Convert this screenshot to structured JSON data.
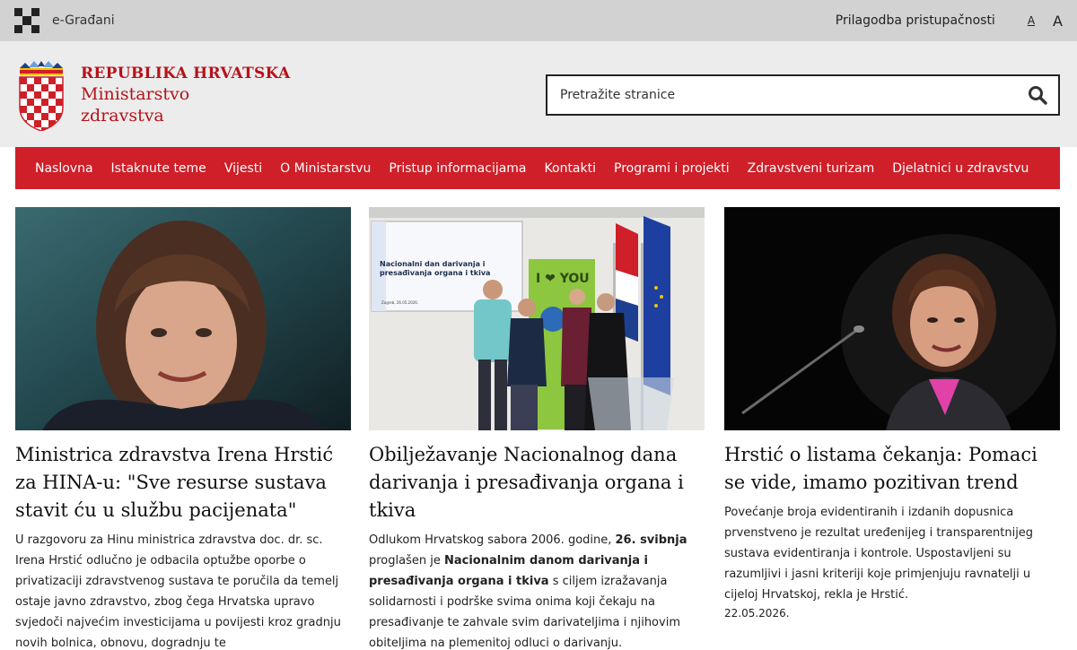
{
  "topbar": {
    "egradjani": "e-Građani",
    "accessibility": "Prilagodba pristupačnosti",
    "font_small": "A",
    "font_large": "A"
  },
  "header": {
    "country": "REPUBLIKA HRVATSKA",
    "ministry_line1": "Ministarstvo",
    "ministry_line2": "zdravstva",
    "search_placeholder": "Pretražite stranice"
  },
  "nav": [
    "Naslovna",
    "Istaknute teme",
    "Vijesti",
    "O Ministarstvu",
    "Pristup informacijama",
    "Kontakti",
    "Programi i projekti",
    "Zdravstveni turizam",
    "Djelatnici u zdravstvu"
  ],
  "colors": {
    "brand_red": "#cf1f28",
    "topbar_gray": "#d2d2d2",
    "header_gray": "#ececec"
  },
  "cards": [
    {
      "title": "Ministrica zdravstva Irena Hrstić za HINA-u: \"Sve resurse sustava stavit ću u službu pacijenata\"",
      "text": "U razgovoru za Hinu ministrica zdravstva doc. dr. sc. Irena Hrstić odlučno je odbacila optužbe oporbe o privatizaciji zdravstvenog sustava te poručila da temelj ostaje javno zdravstvo, zbog čega Hrvatska upravo svjedoči najvećim investicijama u povijesti kroz gradnju novih bolnica, obnovu, dogradnju te"
    },
    {
      "title": "Obilježavanje Nacionalnog dana darivanja i presađivanja organa i tkiva",
      "text_a": "Odlukom Hrvatskog sabora 2006. godine, ",
      "text_b": "26. svibnja",
      "text_c": " proglašen je ",
      "text_d": "Nacionalnim danom darivanja i presađivanja organa i tkiva",
      "text_e": " s ciljem izražavanja solidarnosti i podrške svima onima koji čekaju na presađivanje te zahvale svim darivateljima i njihovim obiteljima na plemenitoj odluci o darivanju.",
      "screen_title": "Nacionalni dan darivanja i presađivanja organa i tkiva",
      "screen_date": "Zagreb, 26.05.2026.",
      "banner_text": "I ❤ YOU"
    },
    {
      "title": "Hrstić o listama čekanja: Pomaci se vide, imamo pozitivan trend",
      "text": "Povećanje broja evidentiranih i izdanih dopusnica prvenstveno je rezultat uređenijeg i transparentnijeg sustava evidentiranja i kontrole. Uspostavljeni su razumljivi i jasni kriteriji koje primjenjuju ravnatelji u cijeloj Hrvatskoj, rekla je Hrstić.",
      "date": "22.05.2026."
    }
  ]
}
